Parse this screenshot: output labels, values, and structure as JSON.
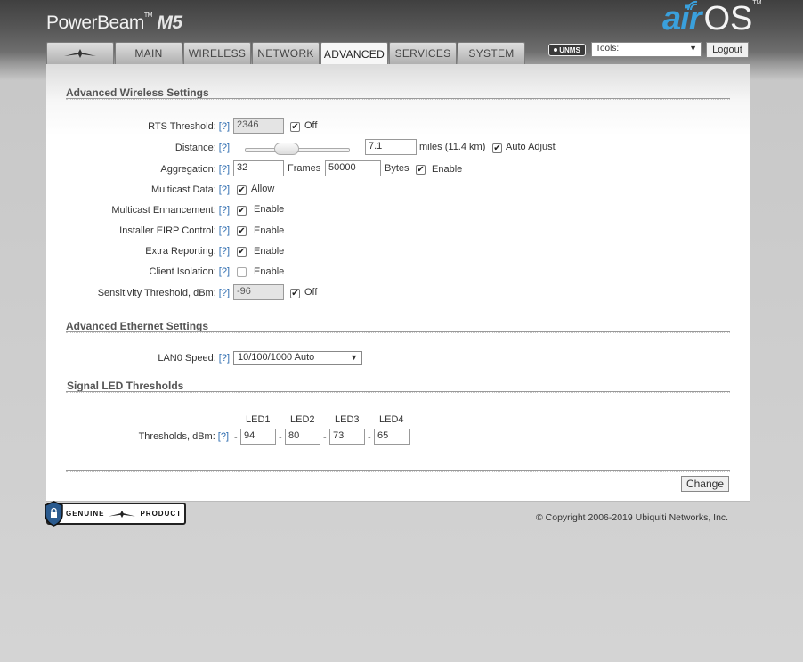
{
  "header": {
    "product_name": "PowerBeam",
    "product_tm": "TM",
    "product_model": "M5",
    "os_logo_air": "air",
    "os_logo_os": "OS",
    "os_logo_tm": "TM"
  },
  "tabs": [
    {
      "label": ""
    },
    {
      "label": "MAIN"
    },
    {
      "label": "WIRELESS"
    },
    {
      "label": "NETWORK"
    },
    {
      "label": "ADVANCED",
      "active": true
    },
    {
      "label": "SERVICES"
    },
    {
      "label": "SYSTEM"
    }
  ],
  "toolbar": {
    "unms_label": "UNMS",
    "tools_selected": "Tools:",
    "logout_label": "Logout"
  },
  "help_label": "[?]",
  "wireless": {
    "title": "Advanced Wireless Settings",
    "rts_label": "RTS Threshold:",
    "rts_value": "2346",
    "rts_off_label": "Off",
    "distance_label": "Distance:",
    "distance_value": "7.1",
    "distance_units": "miles (11.4 km)",
    "auto_adjust_label": "Auto Adjust",
    "distance_slider_fraction": 0.38,
    "aggregation_label": "Aggregation:",
    "aggregation_frames": "32",
    "frames_label": "Frames",
    "aggregation_bytes": "50000",
    "bytes_label": "Bytes",
    "aggregation_enable_label": "Enable",
    "multicast_label": "Multicast Data:",
    "multicast_allow_label": "Allow",
    "multicast_enh_label": "Multicast Enhancement:",
    "multicast_enh_enable": "Enable",
    "eirp_label": "Installer EIRP Control:",
    "eirp_enable": "Enable",
    "extra_label": "Extra Reporting:",
    "extra_enable": "Enable",
    "isolation_label": "Client Isolation:",
    "isolation_enable": "Enable",
    "sensitivity_label": "Sensitivity Threshold, dBm:",
    "sensitivity_value": "-96",
    "sensitivity_off_label": "Off"
  },
  "ethernet": {
    "title": "Advanced Ethernet Settings",
    "lan0_label": "LAN0 Speed:",
    "lan0_selected": "10/100/1000 Auto"
  },
  "led": {
    "title": "Signal LED Thresholds",
    "headers": [
      "LED1",
      "LED2",
      "LED3",
      "LED4"
    ],
    "thresholds_label": "Thresholds, dBm:",
    "dash": "-",
    "values": [
      "94",
      "80",
      "73",
      "65"
    ]
  },
  "actions": {
    "change_label": "Change"
  },
  "footer": {
    "badge_left": "GENUINE",
    "badge_right": "PRODUCT",
    "copyright": "© Copyright 2006-2019 Ubiquiti Networks, Inc."
  }
}
